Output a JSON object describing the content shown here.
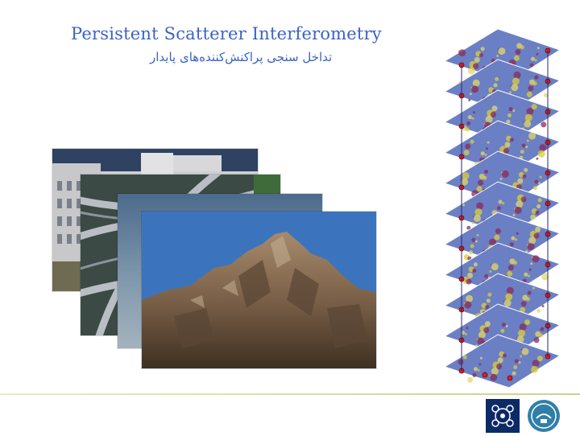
{
  "slide": {
    "title": "Persistent Scatterer Interferometry",
    "subtitle": "تداخل سنجی پراکنش‌کننده‌های پایدار"
  },
  "images": [
    {
      "name": "building-photo"
    },
    {
      "name": "highway-interchange-photo"
    },
    {
      "name": "sky-photo"
    },
    {
      "name": "rocky-mountain-photo"
    }
  ],
  "interferogram_stack": {
    "layers": 11
  },
  "logos": [
    {
      "icon": "molecule-logo-icon"
    },
    {
      "icon": "university-emblem-icon"
    }
  ],
  "colors": {
    "title": "#3a63c4",
    "plane": "#6b7fc4",
    "scatter_point": "#e01b1b",
    "divider": "#c9d28e"
  }
}
